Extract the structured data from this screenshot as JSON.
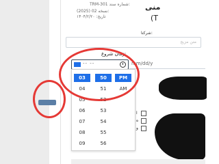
{
  "left_panel": {
    "badge_text": ""
  },
  "header": {
    "title_fragment": "منی",
    "title_paren": "(T",
    "meta_line_1": "TRM-301 شماره سند:",
    "meta_line_2": "(2025) 02 نسخه:",
    "meta_line_3": "تاریخ: ۱۴۰۴/۲/۲۰"
  },
  "form": {
    "company_label": "شرکتا:",
    "company_placeholder": "متن مزیج",
    "start_label": "زمان شروع:",
    "time_value": "-- --",
    "date_placeholder": "mm/dd/y"
  },
  "time_picker": {
    "hours": [
      "03",
      "04",
      "05",
      "06",
      "07",
      "08",
      "09"
    ],
    "minutes": [
      "50",
      "51",
      "52",
      "53",
      "54",
      "55",
      "56"
    ],
    "ampm": [
      "PM",
      "AM"
    ],
    "selected": {
      "hour": "03",
      "minute": "50",
      "ampm": "PM"
    }
  },
  "checkboxes": [
    {
      "label": "ا"
    },
    {
      "label": "ه"
    },
    {
      "label": "و"
    }
  ],
  "colors": {
    "selection_blue": "#1e6fe8",
    "annotation_red": "#e53935"
  }
}
